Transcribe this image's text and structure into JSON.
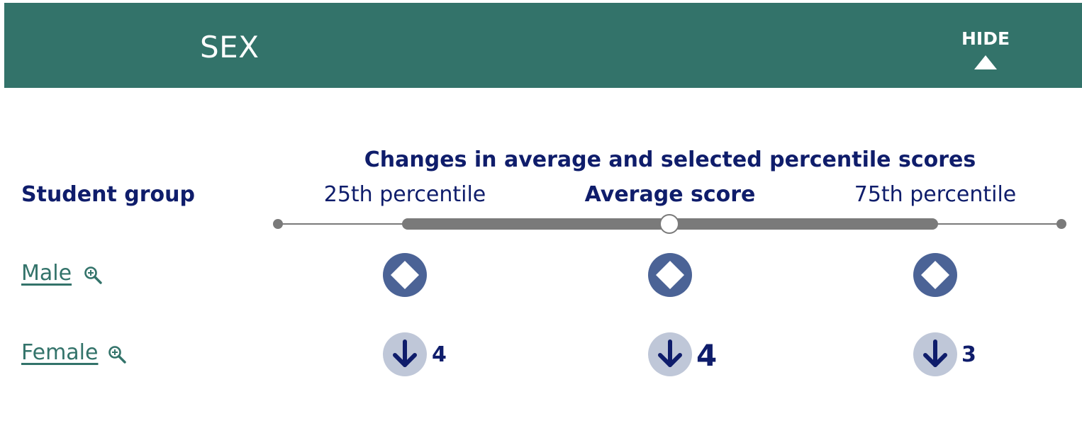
{
  "header": {
    "title": "SEX",
    "hide_label": "HIDE",
    "background_color": "#33736a"
  },
  "chart": {
    "title": "Changes in average and selected percentile scores",
    "group_column_header": "Student group",
    "columns": [
      {
        "label": "25th percentile"
      },
      {
        "label": "Average score"
      },
      {
        "label": "75th percentile"
      }
    ]
  },
  "rows": [
    {
      "label": "Male",
      "cells": [
        {
          "icon": "no-change-diamond-icon",
          "value": ""
        },
        {
          "icon": "no-change-diamond-icon",
          "value": ""
        },
        {
          "icon": "no-change-diamond-icon",
          "value": ""
        }
      ]
    },
    {
      "label": "Female",
      "cells": [
        {
          "icon": "decrease-arrow-icon",
          "value": "4"
        },
        {
          "icon": "decrease-arrow-icon",
          "value": "4"
        },
        {
          "icon": "decrease-arrow-icon",
          "value": "3"
        }
      ]
    }
  ],
  "colors": {
    "title_navy": "#0f1d6b",
    "link_green": "#33736a",
    "no_change_marker": "#4b6396",
    "decrease_marker": "#bfc7d8",
    "scale_gray": "#7a7a7a"
  }
}
